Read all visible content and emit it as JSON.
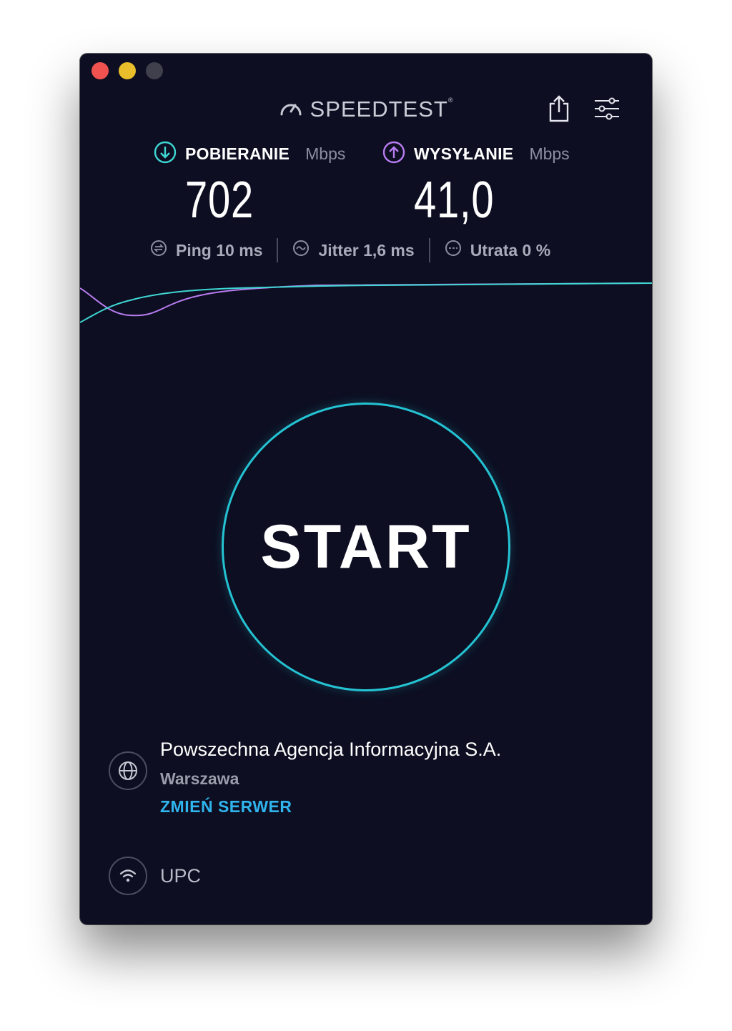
{
  "window": {
    "controls": [
      "close",
      "minimize",
      "zoom"
    ]
  },
  "header": {
    "brand": "SPEEDTEST",
    "trademark": "®",
    "share_icon": "share-icon",
    "settings_icon": "settings-sliders-icon"
  },
  "download": {
    "label": "POBIERANIE",
    "unit": "Mbps",
    "value": "702",
    "icon": "download-arrow-icon",
    "color": "#3ed6d2"
  },
  "upload": {
    "label": "WYSYŁANIE",
    "unit": "Mbps",
    "value": "41,0",
    "icon": "upload-arrow-icon",
    "color": "#b77cf0"
  },
  "stats": {
    "ping": "Ping 10 ms",
    "jitter": "Jitter 1,6 ms",
    "loss": "Utrata 0 %"
  },
  "start": {
    "label": "START",
    "ring_color": "#24c3d3"
  },
  "server": {
    "name": "Powszechna Agencja Informacyjna S.A.",
    "city": "Warszawa",
    "change_label": "ZMIEŃ SERWER",
    "icon": "globe-icon"
  },
  "isp": {
    "name": "UPC",
    "icon": "wifi-icon"
  }
}
